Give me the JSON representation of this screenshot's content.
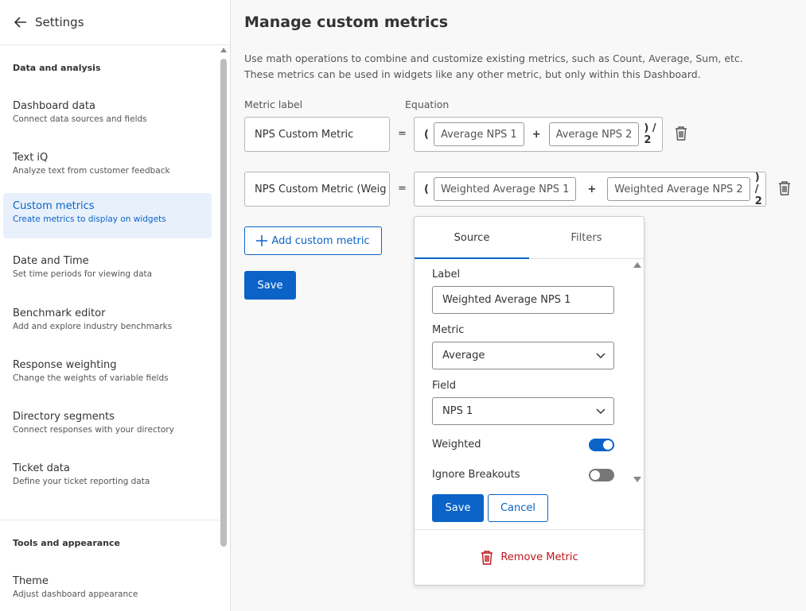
{
  "sidebar": {
    "title": "Settings",
    "section1": "Data and analysis",
    "items": [
      {
        "title": "Dashboard data",
        "subtitle": "Connect data sources and fields"
      },
      {
        "title": "Text iQ",
        "subtitle": "Analyze text from customer feedback"
      },
      {
        "title": "Custom metrics",
        "subtitle": "Create metrics to display on widgets"
      },
      {
        "title": "Date and Time",
        "subtitle": "Set time periods for viewing data"
      },
      {
        "title": "Benchmark editor",
        "subtitle": "Add and explore industry benchmarks"
      },
      {
        "title": "Response weighting",
        "subtitle": "Change the weights of variable fields"
      },
      {
        "title": "Directory segments",
        "subtitle": "Connect responses with your directory"
      },
      {
        "title": "Ticket data",
        "subtitle": "Define your ticket reporting data"
      }
    ],
    "section2": "Tools and appearance",
    "items2": [
      {
        "title": "Theme",
        "subtitle": "Adjust dashboard appearance"
      }
    ]
  },
  "main": {
    "title": "Manage custom metrics",
    "description_line1": "Use math operations to combine and customize existing metrics, such as Count, Average, Sum, etc.",
    "description_line2": "These metrics can be used in widgets like any other metric, but only within this Dashboard.",
    "metric_label_header": "Metric label",
    "equation_header": "Equation",
    "metrics": [
      {
        "label": "NPS Custom Metric",
        "equals": "=",
        "open": "(",
        "operand1": "Average NPS 1",
        "operator": "+",
        "operand2": "Average NPS 2",
        "tail": ") / 2"
      },
      {
        "label": "NPS Custom Metric (Weig",
        "equals": "=",
        "open": "(",
        "operand1": "Weighted Average NPS 1",
        "operator": "+",
        "operand2": "Weighted Average NPS 2",
        "tail": ") / 2"
      }
    ],
    "add_button": "Add custom metric",
    "save_button": "Save"
  },
  "popover": {
    "tab_source": "Source",
    "tab_filters": "Filters",
    "label_label": "Label",
    "label_value": "Weighted Average NPS 1",
    "metric_label": "Metric",
    "metric_value": "Average",
    "field_label": "Field",
    "field_value": "NPS 1",
    "weighted_label": "Weighted",
    "weighted_on": true,
    "ignore_label": "Ignore Breakouts",
    "ignore_on": false,
    "save": "Save",
    "cancel": "Cancel",
    "remove": "Remove Metric"
  },
  "colors": {
    "accent": "#0b63c8",
    "danger": "#c0141c",
    "active_bg": "#e8f0fb"
  }
}
